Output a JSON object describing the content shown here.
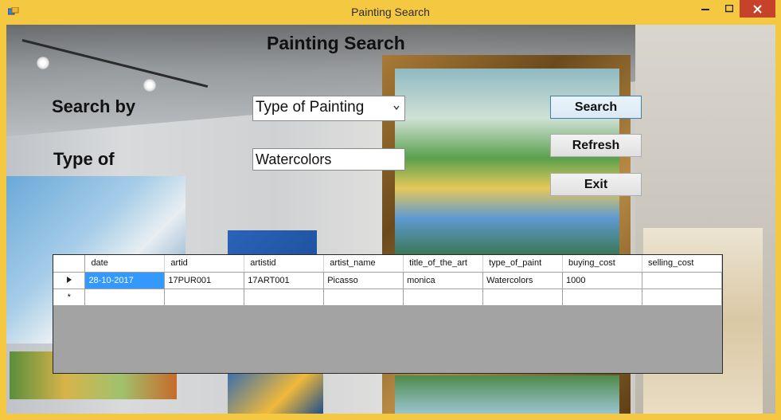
{
  "window": {
    "title": "Painting Search"
  },
  "form": {
    "heading": "Painting Search",
    "search_by_label": "Search by",
    "type_of_label": "Type of",
    "search_by_value": "Type of Painting",
    "type_of_value": "Watercolors"
  },
  "buttons": {
    "search": "Search",
    "refresh": "Refresh",
    "exit": "Exit"
  },
  "grid": {
    "columns": [
      "date",
      "artid",
      "artistid",
      "artist_name",
      "title_of_the_art",
      "type_of_paint",
      "buying_cost",
      "selling_cost"
    ],
    "rows": [
      [
        "28-10-2017",
        "17PUR001",
        "17ART001",
        "Picasso",
        "monica",
        "Watercolors",
        "1000",
        ""
      ]
    ],
    "new_row_marker": "*"
  },
  "icons": {
    "current_row": "triangle-right-icon",
    "close": "close-icon"
  }
}
